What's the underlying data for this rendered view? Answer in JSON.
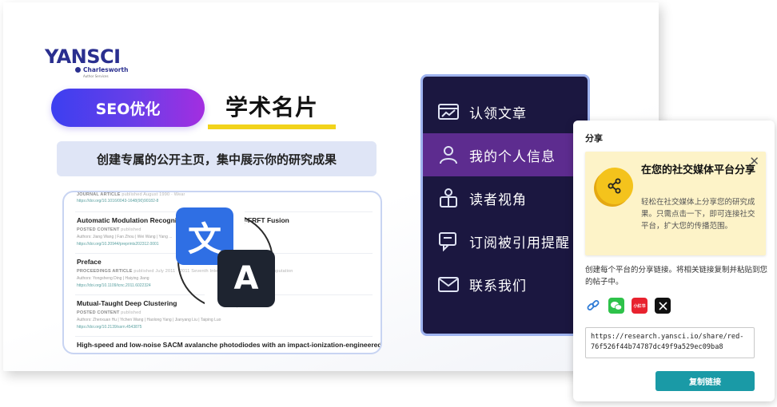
{
  "brand": {
    "logo_main": "YANSCI",
    "logo_sub": "Charlesworth",
    "logo_sub2": "Author Services"
  },
  "slide": {
    "seo_pill": "SEO优化",
    "headline": "学术名片",
    "sub_banner": "创建专属的公开主页，集中展示你的研究成果"
  },
  "publications": [
    {
      "title": "",
      "meta_type": "JOURNAL ARTICLE",
      "meta_extra": "published August 1990 · Wear",
      "authors": "",
      "doi": "https://doi.org/10.1016/0043-1648(90)90182-8"
    },
    {
      "title": "Automatic Modulation Recognition ... Multimodal I/Q-FRFT Fusion",
      "meta_type": "POSTED CONTENT",
      "meta_extra": "published",
      "authors": "Authors: Jiang Wang | Fan Zhou | Wei Wang | Yang ...",
      "doi": "https://doi.org/10.20944/preprints202312.0001"
    },
    {
      "title": "Preface",
      "meta_type": "PROCEEDINGS ARTICLE",
      "meta_extra": "published July 2011 · 2011 Seventh International ... on Natural Computation",
      "authors": "Authors: Yongsheng Ding | Haiying Jiang",
      "doi": "https://doi.org/10.1109/icnc.2011.6022324"
    },
    {
      "title": "Mutual-Taught Deep Clustering",
      "meta_type": "POSTED CONTENT",
      "meta_extra": "published",
      "authors": "Authors: Zhenxuan Hu | Yichen Wang | Haolong Yang | Jianyang Liu | Taiping Luo",
      "doi": "https://doi.org/10.2139/ssrn.4543875"
    },
    {
      "title": "High-speed and low-noise SACM avalanche photodiodes with an impact-ionization-engineered multi",
      "meta_type": "",
      "meta_extra": "",
      "authors": "",
      "doi": ""
    }
  ],
  "translate_icon": {
    "glyph_zh": "文",
    "glyph_en": "A"
  },
  "menu": {
    "items": [
      {
        "label": "认领文章",
        "icon": "claim-articles-icon",
        "active": false
      },
      {
        "label": "我的个人信息",
        "icon": "profile-icon",
        "active": true
      },
      {
        "label": "读者视角",
        "icon": "reader-view-icon",
        "active": false
      },
      {
        "label": "订阅被引用提醒",
        "icon": "citation-alert-icon",
        "active": false
      },
      {
        "label": "联系我们",
        "icon": "mail-icon",
        "active": false
      }
    ],
    "colors": {
      "bg": "#1b1740",
      "active": "#5d2c8f",
      "border": "#9fb3ef"
    }
  },
  "share": {
    "title": "分享",
    "callout_heading": "在您的社交媒体平台分享",
    "callout_body": "轻松在社交媒体上分享您的研究成果。只需点击一下，即可连接社交平台，扩大您的传播范围。",
    "instructions": "创建每个平台的分享链接。将相关链接复制并粘贴到您的帖子中。",
    "platforms": [
      {
        "name": "link",
        "icon": "link-icon"
      },
      {
        "name": "wechat",
        "icon": "wechat-icon"
      },
      {
        "name": "小红书",
        "icon": "xiaohongshu-icon"
      },
      {
        "name": "x",
        "icon": "x-icon"
      }
    ],
    "url": "https://research.yansci.io/share/red-76f526f44b74787dc49f9a529ec09ba8",
    "copy_label": "复制链接",
    "close_glyph": "✕",
    "accent": "#1a9aa6",
    "callout_bg": "#fdf3c8"
  }
}
